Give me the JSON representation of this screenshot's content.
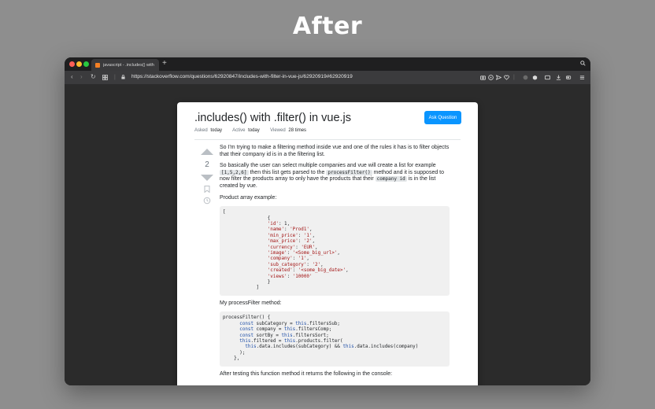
{
  "headline": "After",
  "browser": {
    "tab_title": "javascript - .includes() with .filt",
    "new_tab": "+",
    "url": "https://stackoverflow.com/questions/62920847/includes-with-filter-in-vue-js/62920919#62920919"
  },
  "question": {
    "title": ".includes() with .filter() in vue.js",
    "ask_button": "Ask Question",
    "asked_label": "Asked",
    "asked_value": "today",
    "active_label": "Active",
    "active_value": "today",
    "viewed_label": "Viewed",
    "viewed_value": "28 times",
    "score": "2"
  },
  "post": {
    "p1": "So I'm trying to make a filtering method inside vue and one of the rules it has is to filter objects that their company id is in a the filtering list.",
    "p2a": "So basically the user can select multiple companies and vue will create a list for example",
    "p2_code1": "[1,5,2,6]",
    "p2b": "then this list gets parsed to the",
    "p2_code2": "processFilter()",
    "p2c": "method and it is supposed to now filter the products array to only have the products that their",
    "p2_code3": "company id",
    "p2d": "is in the list created by vue.",
    "p3": "Product array example:",
    "code1": [
      "[",
      "                {",
      "                'id': 1,",
      "                'name': 'Prod1',",
      "                'min_price': '1',",
      "                'max_price': '2',",
      "                'currency': 'EUR',",
      "                'image': '<Some_big_url>',",
      "                'company': '1',",
      "                'sub_category': '2',",
      "                'created': '<some_big_date>',",
      "                'views': '10000'",
      "                }",
      "            ]"
    ],
    "p4": "My processFilter method:",
    "code2": [
      "processFilter() {",
      "      const subCategory = this.filtersSub;",
      "      const company = this.filtersComp;",
      "      const sortBy = this.filtersSort;",
      "      this.filtered = this.products.filter(",
      "        this.data.includes(subCategory) && this.data.includes(company)",
      "      );",
      "    },"
    ],
    "p5": "After testing this function method it returns the following in the console:"
  },
  "colors": {
    "ask_button": "#0a95ff",
    "page_bg": "#8e8e8e",
    "browser_bg": "#2b2b2b"
  }
}
